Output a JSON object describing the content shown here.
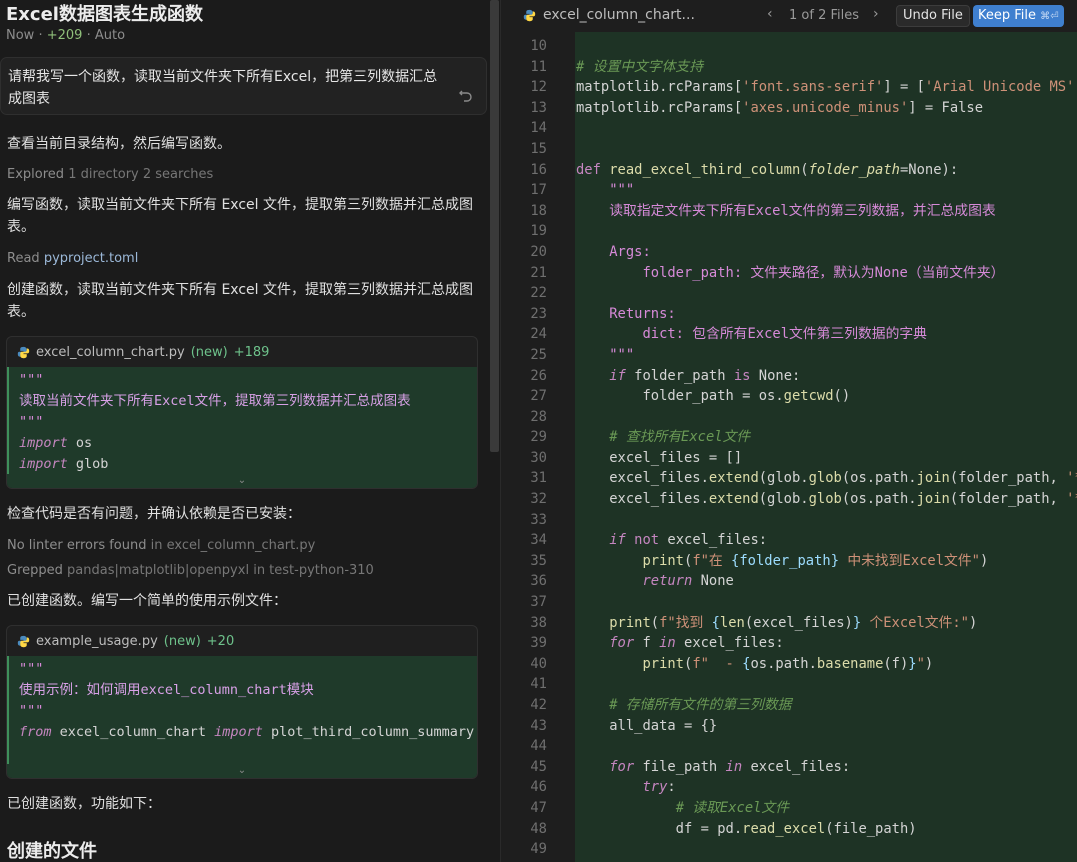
{
  "chat": {
    "title": "Excel数据图表生成函数",
    "meta_time": "Now",
    "meta_added": "+209",
    "meta_mode": "Auto",
    "user_message": "请帮我写一个函数，读取当前文件夹下所有Excel，把第三列数据汇总成图表",
    "messages": [
      "查看当前目录结构，然后编写函数。",
      "编写函数，读取当前文件夹下所有 Excel 文件，提取第三列数据并汇总成图表。",
      "创建函数，读取当前文件夹下所有 Excel 文件，提取第三列数据并汇总成图表。",
      "检查代码是否有问题，并确认依赖是否已安装：",
      "已创建函数。编写一个简单的使用示例文件：",
      "已创建函数，功能如下："
    ],
    "steps": {
      "explored_label": "Explored",
      "explored_detail": "1 directory 2 searches",
      "read_label": "Read",
      "read_file": "pyproject.toml",
      "linter_label": "No linter errors found",
      "linter_in": "in excel_column_chart.py",
      "grepped_label": "Grepped",
      "grepped_detail": "pandas|matplotlib|openpyxl",
      "grepped_in": "in test-python-310"
    },
    "card1": {
      "file": "excel_column_chart.py",
      "status": "(new)",
      "added": "+189",
      "lines": [
        "\"\"\"",
        "读取当前文件夹下所有Excel文件，提取第三列数据并汇总成图表",
        "\"\"\"",
        "import",
        " os",
        "import",
        " glob"
      ]
    },
    "card2": {
      "file": "example_usage.py",
      "status": "(new)",
      "added": "+20",
      "lines": [
        "\"\"\"",
        "使用示例：如何调用excel_column_chart模块",
        "\"\"\"",
        "from",
        " excel_column_chart ",
        "import",
        " plot_third_column_summary"
      ]
    },
    "section_heading": "创建的文件"
  },
  "editor": {
    "tab_file": "excel_column_chart...",
    "nav_prev": "‹",
    "nav_count": "1 of 2 Files",
    "nav_next": "›",
    "undo_label": "Undo File",
    "keep_label": "Keep File",
    "keep_shortcut": "⌘⏎",
    "line_numbers": [
      "10",
      "11",
      "12",
      "13",
      "14",
      "15",
      "16",
      "17",
      "18",
      "19",
      "20",
      "21",
      "22",
      "23",
      "24",
      "25",
      "26",
      "27",
      "28",
      "29",
      "30",
      "31",
      "32",
      "33",
      "34",
      "35",
      "36",
      "37",
      "38",
      "39",
      "40",
      "41",
      "42",
      "43",
      "44",
      "45",
      "46",
      "47",
      "48",
      "49"
    ]
  },
  "colors": {
    "accent_blue": "#3f7fcf",
    "diff_green": "#1e3325",
    "added_green": "#6ec28b"
  }
}
